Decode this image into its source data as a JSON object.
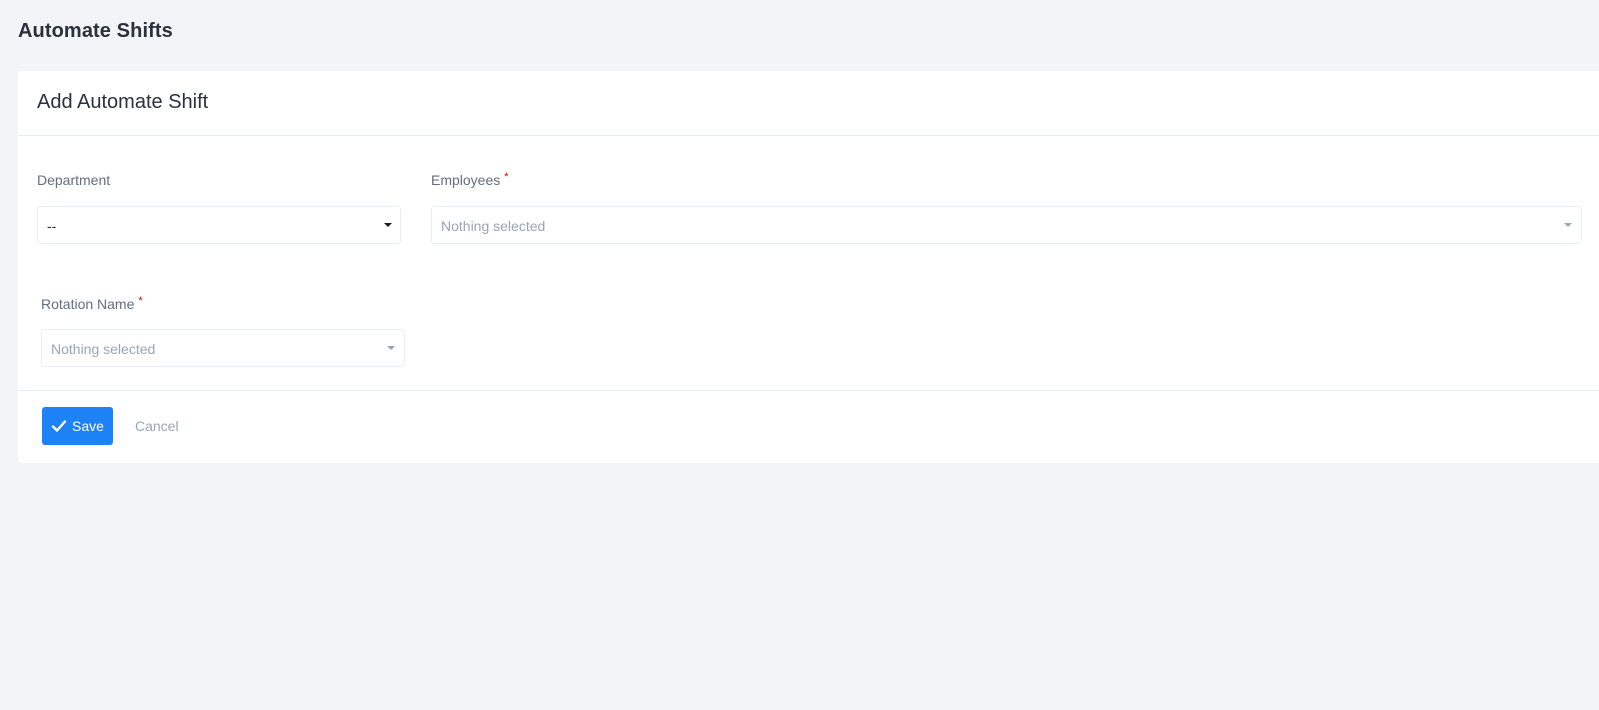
{
  "page": {
    "title": "Automate Shifts"
  },
  "card": {
    "title": "Add Automate Shift"
  },
  "form": {
    "department": {
      "label": "Department",
      "value": "--"
    },
    "employees": {
      "label": "Employees",
      "required_mark": "*",
      "placeholder": "Nothing selected"
    },
    "rotation_name": {
      "label": "Rotation Name",
      "required_mark": "*",
      "placeholder": "Nothing selected"
    }
  },
  "actions": {
    "save_label": "Save",
    "save_icon": "check-icon",
    "cancel_label": "Cancel"
  },
  "colors": {
    "background": "#f2f4f7",
    "card": "#ffffff",
    "primary": "#1d82f5",
    "required": "#d30000",
    "muted_text": "#99a5b5"
  }
}
